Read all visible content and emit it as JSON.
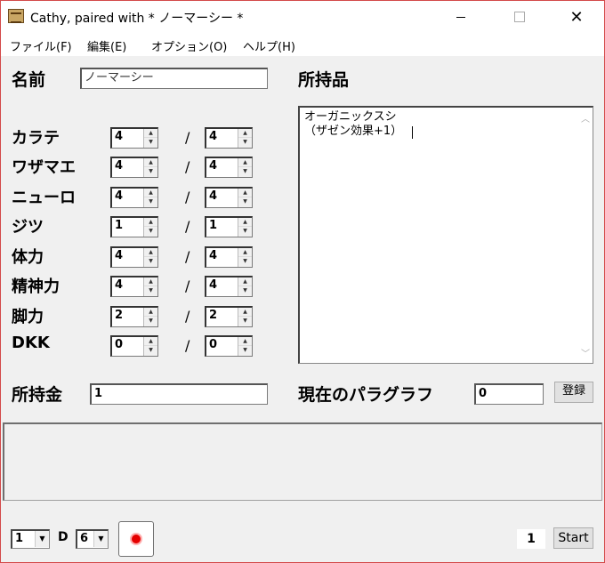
{
  "window": {
    "title": "Cathy, paired with * ノーマーシー *",
    "close_glyph": "✕"
  },
  "menu": {
    "items": [
      "ファイル(F)",
      "編集(E)",
      "オプション(O)",
      "ヘルプ(H)"
    ]
  },
  "form": {
    "name_label": "名前",
    "name_value": "ノーマーシー",
    "items_label": "所持品",
    "items_text": "オーガニックスシ\n（ザゼン効果+1）",
    "money_label": "所持金",
    "money_value": "1",
    "paragraph_label": "現在のパラグラフ",
    "paragraph_value": "0",
    "register_button": "登録"
  },
  "stats": [
    {
      "label": "カラテ",
      "current": "4",
      "max": "4"
    },
    {
      "label": "ワザマエ",
      "current": "4",
      "max": "4"
    },
    {
      "label": "ニューロ",
      "current": "4",
      "max": "4"
    },
    {
      "label": "ジツ",
      "current": "1",
      "max": "1"
    },
    {
      "label": "体力",
      "current": "4",
      "max": "4"
    },
    {
      "label": "精神力",
      "current": "4",
      "max": "4"
    },
    {
      "label": "脚力",
      "current": "2",
      "max": "2"
    },
    {
      "label": "DKK",
      "current": "0",
      "max": "0"
    }
  ],
  "stat_separator": "/",
  "dice": {
    "count": "1",
    "d_label": "D",
    "sides": "6",
    "result": "1",
    "start_button": "Start"
  },
  "icons": {
    "app": "book-icon",
    "record": "record-icon",
    "spin_up": "▲",
    "spin_down": "▼",
    "combo_arrow": "▼"
  },
  "colors": {
    "record_dot": "#e50000",
    "window_border": "#d34a4a"
  }
}
